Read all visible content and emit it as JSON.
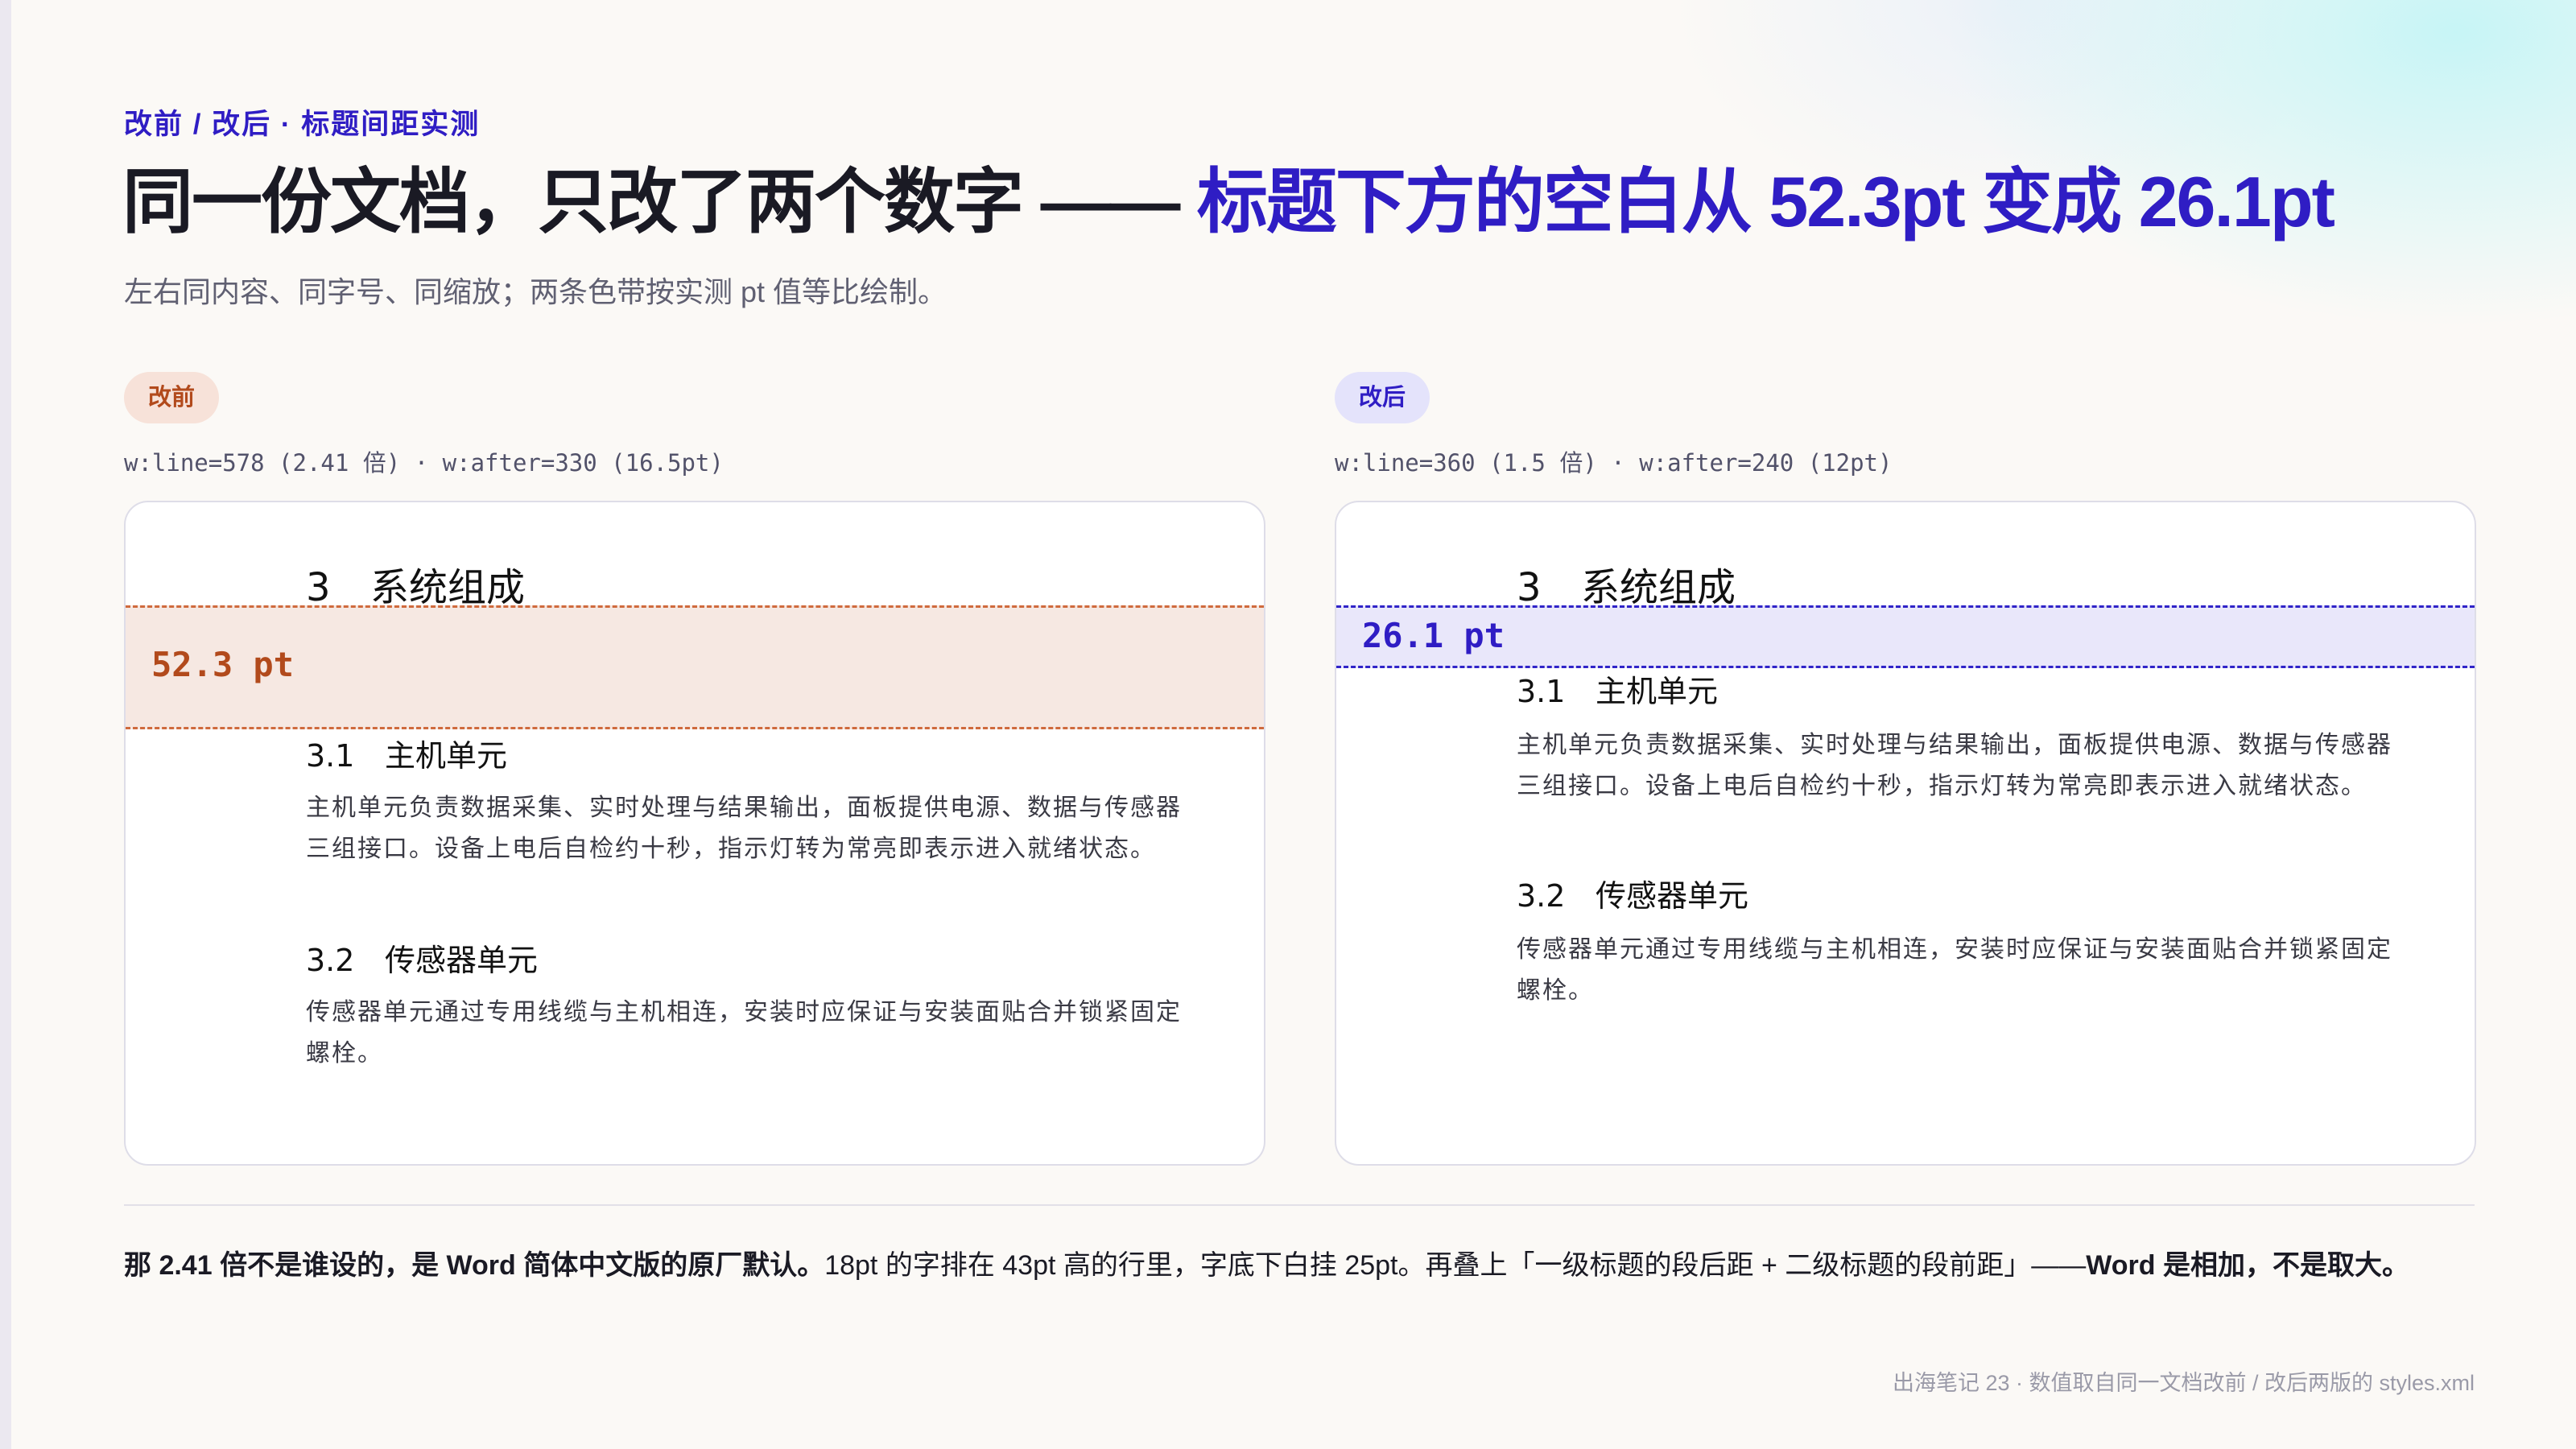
{
  "eyebrow": "改前 / 改后 · 标题间距实测",
  "headline": {
    "main": "同一份文档，只改了两个数字 —— ",
    "accent": "标题下方的空白从 52.3pt 变成 26.1pt"
  },
  "subtitle": "左右同内容、同字号、同缩放；两条色带按实测 pt 值等比绘制。",
  "colors": {
    "accent": "#2f1dc4",
    "before": "#b24a1c",
    "before_band": "#f6e8e2",
    "after_band": "#e9e7fa"
  },
  "before": {
    "tag": "改前",
    "params": "w:line=578 (2.41 倍) · w:after=330 (16.5pt)",
    "gap_label": "52.3 pt",
    "gap_pt": 52.3
  },
  "after": {
    "tag": "改后",
    "params": "w:line=360 (1.5 倍) · w:after=240 (12pt)",
    "gap_label": "26.1 pt",
    "gap_pt": 26.1
  },
  "document": {
    "h1_num": "3",
    "h1_text": "系统组成",
    "s1_num": "3.1",
    "s1_text": "主机单元",
    "s1_body": "主机单元负责数据采集、实时处理与结果输出，面板提供电源、数据与传感器三组接口。设备上电后自检约十秒，指示灯转为常亮即表示进入就绪状态。",
    "s2_num": "3.2",
    "s2_text": "传感器单元",
    "s2_body": "传感器单元通过专用线缆与主机相连，安装时应保证与安装面贴合并锁紧固定螺栓。"
  },
  "takeaway": {
    "bold1": "那 2.41 倍不是谁设的，是 Word 简体中文版的原厂默认。",
    "normal": "18pt 的字排在 43pt 高的行里，字底下白挂 25pt。再叠上「一级标题的段后距 + 二级标题的段前距」——",
    "bold2": "Word 是相加，不是取大。"
  },
  "footnote": "出海笔记 23 · 数值取自同一文档改前 / 改后两版的 styles.xml"
}
